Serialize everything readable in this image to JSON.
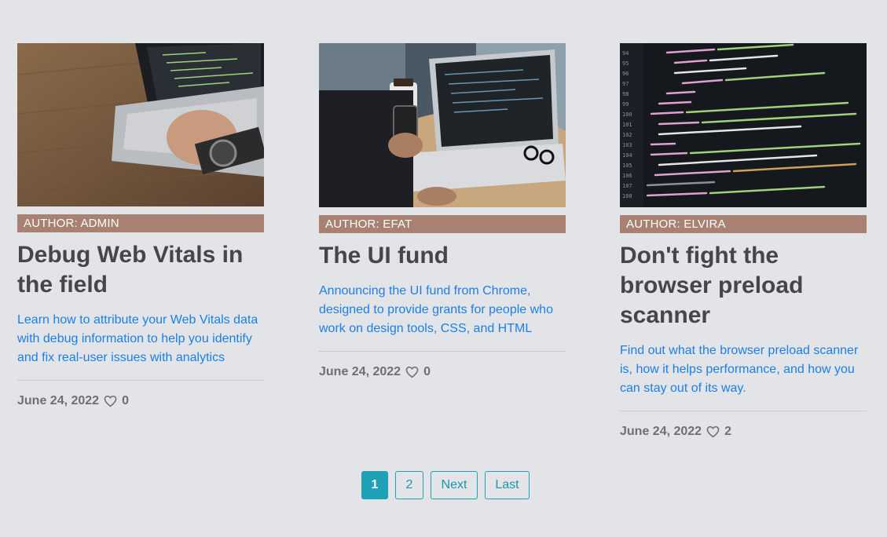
{
  "posts": [
    {
      "author": "AUTHOR: ADMIN",
      "title": "Debug Web Vitals in the field",
      "description": "Learn how to attribute your Web Vitals data with debug information to help you identify and fix real-user issues with analytics",
      "date": "June 24, 2022",
      "likes": "0",
      "image": "laptop-coding-photo"
    },
    {
      "author": "AUTHOR: EFAT",
      "title": "The UI fund",
      "description": "Announcing the UI fund from Chrome, designed to provide grants for people who work on design tools, CSS, and HTML",
      "date": "June 24, 2022",
      "likes": "0",
      "image": "laptop-phone-photo"
    },
    {
      "author": "AUTHOR: ELVIRA",
      "title": "Don't fight the browser preload scanner",
      "description": "Find out what the browser preload scanner is, how it helps performance, and how you can stay out of its way.",
      "date": "June 24, 2022",
      "likes": "2",
      "image": "code-screen-photo"
    }
  ],
  "pagination": {
    "pages": [
      "1",
      "2"
    ],
    "current": "1",
    "next_label": "Next",
    "last_label": "Last"
  },
  "colors": {
    "background": "#e3e4e7",
    "author_bar": "#a98172",
    "link_blue": "#1b7fe6",
    "accent_teal": "#1fa1b8"
  }
}
